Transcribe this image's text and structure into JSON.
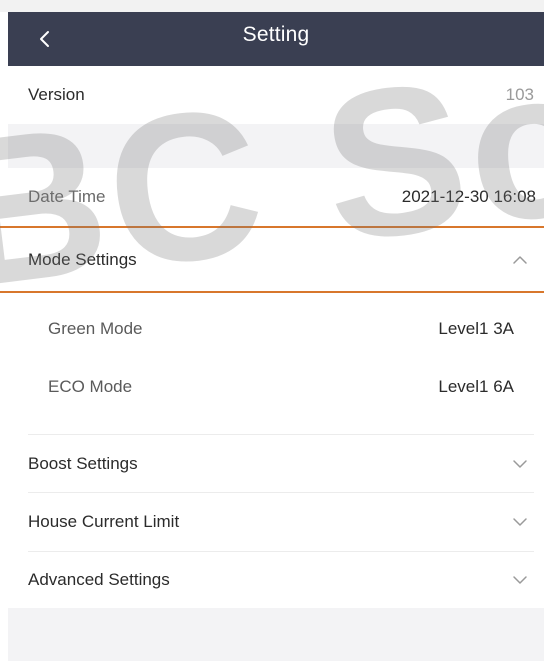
{
  "header": {
    "title": "Setting",
    "back_icon": "chevron-left-icon"
  },
  "rows": {
    "version": {
      "label": "Version",
      "value": "103"
    },
    "datetime": {
      "label": "Date Time",
      "value": "2021-12-30 16:08"
    },
    "mode_settings": {
      "label": "Mode Settings",
      "icon": "chevron-up-icon"
    },
    "green_mode": {
      "label": "Green Mode",
      "value": "Level1 3A"
    },
    "eco_mode": {
      "label": "ECO Mode",
      "value": "Level1 6A"
    },
    "boost_settings": {
      "label": "Boost Settings",
      "icon": "chevron-down-icon"
    },
    "house_current_limit": {
      "label": "House Current Limit",
      "icon": "chevron-down-icon"
    },
    "advanced_settings": {
      "label": "Advanced Settings",
      "icon": "chevron-down-icon"
    }
  },
  "watermark": {
    "text": "BC Soli"
  },
  "colors": {
    "navbar": "#3a3f52",
    "highlight": "#d8772c",
    "gap": "#f3f3f5"
  }
}
